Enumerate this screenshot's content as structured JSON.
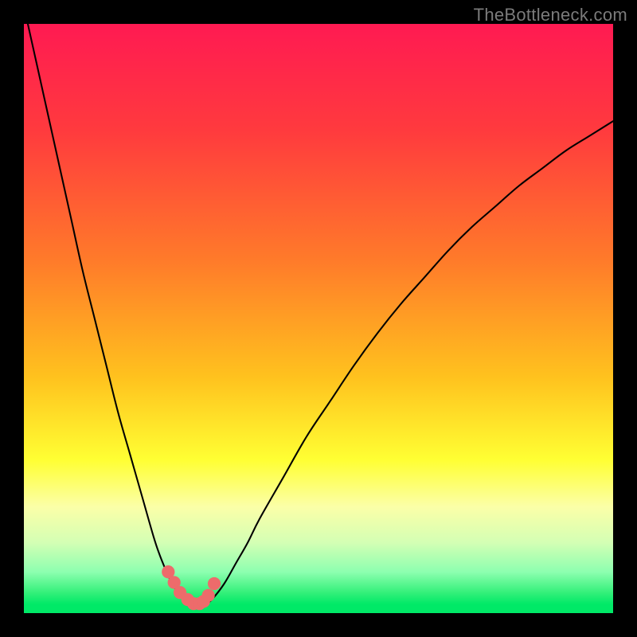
{
  "watermark": "TheBottleneck.com",
  "colors": {
    "frame": "#000000",
    "curve": "#000000",
    "marker": "#ed6b6b",
    "gradient_stops": [
      {
        "offset": 0.0,
        "color": "#ff1a52"
      },
      {
        "offset": 0.18,
        "color": "#ff3a3e"
      },
      {
        "offset": 0.4,
        "color": "#ff7a2a"
      },
      {
        "offset": 0.6,
        "color": "#ffc21e"
      },
      {
        "offset": 0.74,
        "color": "#ffff33"
      },
      {
        "offset": 0.82,
        "color": "#fbffa8"
      },
      {
        "offset": 0.88,
        "color": "#d4ffb4"
      },
      {
        "offset": 0.93,
        "color": "#8dffb0"
      },
      {
        "offset": 0.965,
        "color": "#34f07a"
      },
      {
        "offset": 0.985,
        "color": "#00e967"
      },
      {
        "offset": 1.0,
        "color": "#00e967"
      }
    ]
  },
  "chart_data": {
    "type": "line",
    "title": "",
    "xlabel": "",
    "ylabel": "",
    "xlim": [
      0,
      100
    ],
    "ylim": [
      0,
      100
    ],
    "series": [
      {
        "name": "bottleneck-curve",
        "x": [
          0,
          2,
          4,
          6,
          8,
          10,
          12,
          14,
          16,
          18,
          20,
          22,
          23,
          24,
          25,
          26,
          27,
          28,
          29,
          30,
          31,
          32,
          34,
          36,
          38,
          40,
          44,
          48,
          52,
          56,
          60,
          64,
          68,
          72,
          76,
          80,
          84,
          88,
          92,
          96,
          100
        ],
        "y": [
          103,
          94,
          85,
          76,
          67,
          58,
          50,
          42,
          34,
          27,
          20,
          13,
          10,
          7.5,
          5.3,
          3.6,
          2.4,
          1.6,
          1.2,
          1.2,
          1.6,
          2.4,
          5,
          8.5,
          12,
          16,
          23,
          30,
          36,
          42,
          47.5,
          52.5,
          57,
          61.5,
          65.5,
          69,
          72.5,
          75.5,
          78.5,
          81,
          83.5
        ]
      }
    ],
    "markers": {
      "name": "highlight-points",
      "x": [
        24.5,
        25.5,
        26.5,
        27.8,
        28.8,
        29.8,
        30.5,
        31.3,
        32.3
      ],
      "y": [
        7.0,
        5.2,
        3.5,
        2.3,
        1.6,
        1.6,
        2.0,
        3.0,
        5.0
      ],
      "radius": 1.1
    },
    "gradient_axis": "y",
    "notes": "y represents bottleneck percentage; color gradient maps high y (top, red) to low y (bottom, green). Minimum of curve ≈ (29, 1.2)."
  }
}
